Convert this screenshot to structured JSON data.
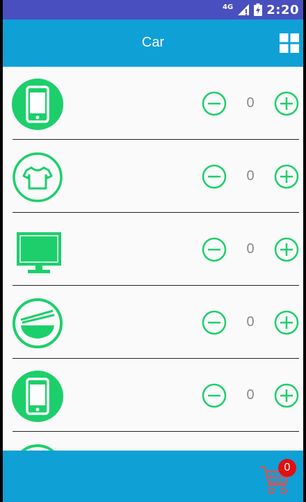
{
  "status_bar": {
    "network": "4G",
    "time": "2:20"
  },
  "app_bar": {
    "title": "Car",
    "menu_icon": "grid-icon"
  },
  "items": [
    {
      "icon": "phone-icon",
      "quantity": "0"
    },
    {
      "icon": "tshirt-icon",
      "quantity": "0"
    },
    {
      "icon": "monitor-icon",
      "quantity": "0"
    },
    {
      "icon": "bowl-icon",
      "quantity": "0"
    },
    {
      "icon": "phone-icon",
      "quantity": "0"
    },
    {
      "icon": "partial-icon",
      "quantity": ""
    }
  ],
  "cart": {
    "icon": "cart-icon",
    "count": "0"
  },
  "colors": {
    "accent": "#1ccf6b",
    "app_bar": "#0fa0d6",
    "status_bar": "#4a4fbf",
    "badge": "#e01010"
  }
}
